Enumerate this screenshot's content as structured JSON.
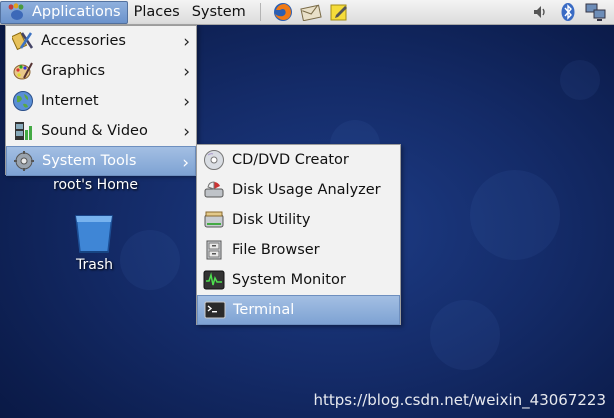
{
  "panel": {
    "menus": [
      "Applications",
      "Places",
      "System"
    ],
    "launchers": [
      "firefox-icon",
      "mail-icon",
      "notes-icon"
    ],
    "tray": [
      "volume-icon",
      "bluetooth-icon",
      "network-icon"
    ]
  },
  "desktop": {
    "icons": [
      {
        "label": "root's Home",
        "icon": "home-folder-icon"
      },
      {
        "label": "Trash",
        "icon": "trash-icon"
      }
    ]
  },
  "applications_menu": {
    "items": [
      {
        "label": "Accessories",
        "icon": "accessories-icon",
        "submenu": true
      },
      {
        "label": "Graphics",
        "icon": "graphics-icon",
        "submenu": true
      },
      {
        "label": "Internet",
        "icon": "internet-globe-icon",
        "submenu": true
      },
      {
        "label": "Sound & Video",
        "icon": "sound-video-icon",
        "submenu": true
      },
      {
        "label": "System Tools",
        "icon": "system-tools-icon",
        "submenu": true,
        "selected": true
      }
    ]
  },
  "system_tools_menu": {
    "items": [
      {
        "label": "CD/DVD Creator",
        "icon": "cd-icon"
      },
      {
        "label": "Disk Usage Analyzer",
        "icon": "disk-usage-icon"
      },
      {
        "label": "Disk Utility",
        "icon": "disk-utility-icon"
      },
      {
        "label": "File Browser",
        "icon": "file-cabinet-icon"
      },
      {
        "label": "System Monitor",
        "icon": "system-monitor-icon"
      },
      {
        "label": "Terminal",
        "icon": "terminal-icon",
        "selected": true
      }
    ]
  },
  "watermark": "https://blog.csdn.net/weixin_43067223",
  "colors": {
    "selection": "#7ea2d3",
    "desktop": "#142b68"
  }
}
